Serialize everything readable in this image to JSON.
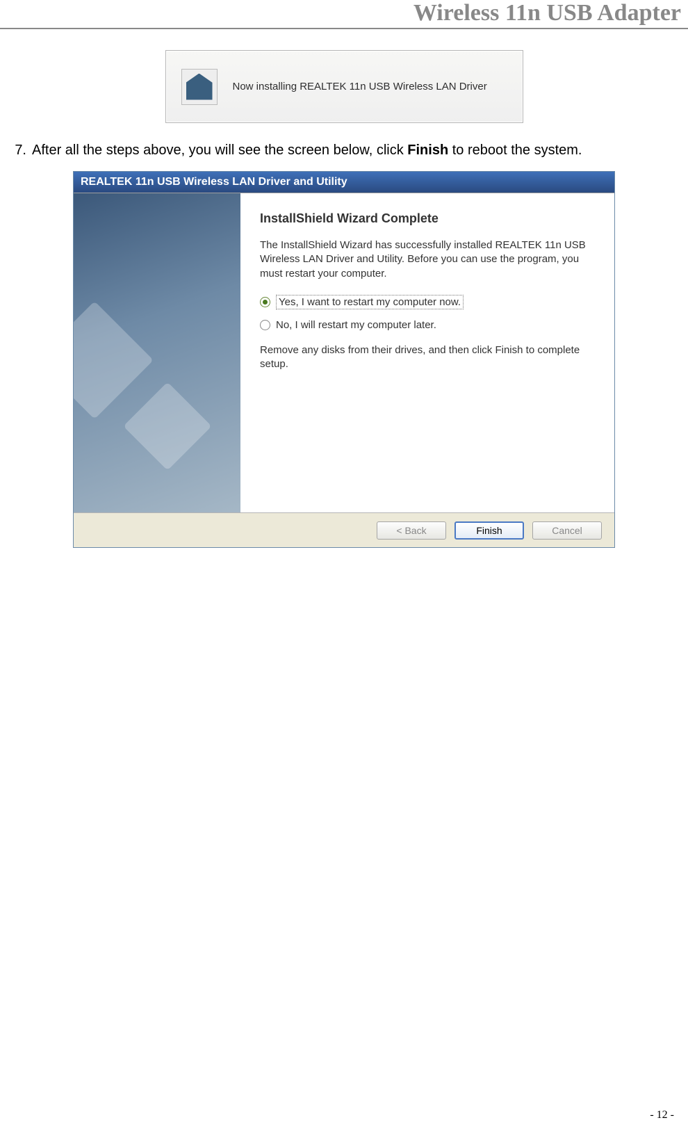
{
  "header": {
    "title": "Wireless 11n USB Adapter"
  },
  "banner": {
    "icon": "box-icon",
    "text": "Now installing REALTEK 11n USB Wireless LAN Driver"
  },
  "step": {
    "number": "7.",
    "text_before": "After all the steps above, you will see the screen below, click ",
    "bold": "Finish",
    "text_after": " to reboot the system."
  },
  "installer": {
    "title": "REALTEK 11n USB Wireless LAN Driver and Utility",
    "heading": "InstallShield Wizard Complete",
    "paragraph": "The InstallShield Wizard has successfully installed REALTEK 11n USB Wireless LAN Driver and Utility.  Before you can use the program, you must restart your computer.",
    "radio_yes": "Yes, I want to restart my computer now.",
    "radio_no": "No, I will restart my computer later.",
    "remove_text": "Remove any disks from their drives, and then click Finish to complete setup.",
    "buttons": {
      "back": "< Back",
      "finish": "Finish",
      "cancel": "Cancel"
    }
  },
  "page_number": "- 12 -"
}
